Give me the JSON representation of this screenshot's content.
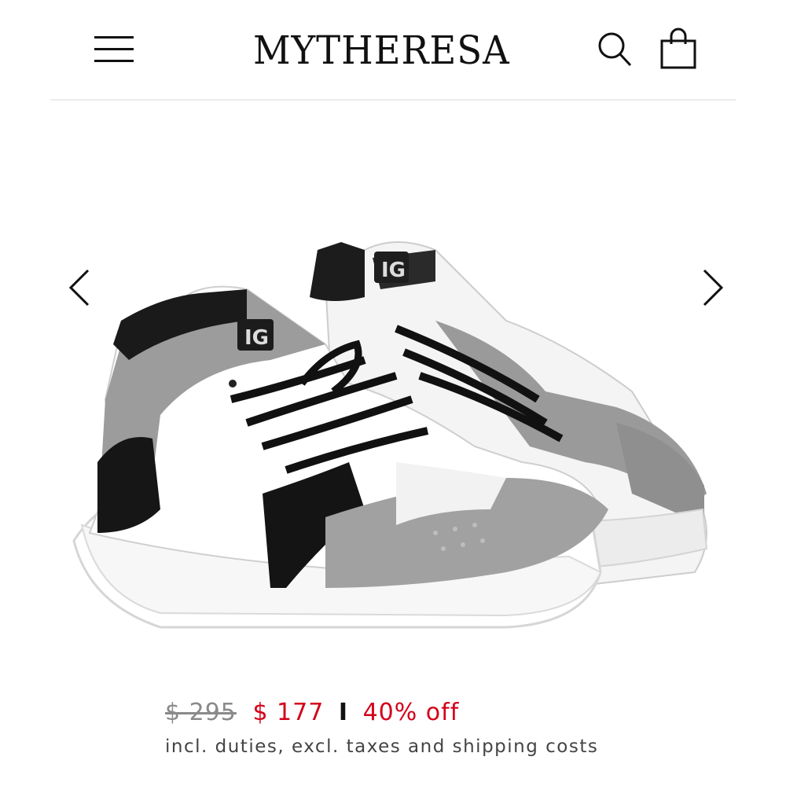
{
  "header": {
    "brand": "MYTHERESA",
    "icons": {
      "menu": "hamburger-menu-icon",
      "search": "search-icon",
      "bag": "shopping-bag-icon"
    }
  },
  "gallery": {
    "image_alt": "White, grey and black leather high-top sneakers with IG tongue logo",
    "prev_icon": "chevron-left-icon",
    "next_icon": "chevron-right-icon"
  },
  "price": {
    "original": "$ 295",
    "current": "$ 177",
    "separator": "I",
    "discount": "40% off",
    "note": "incl. duties, excl. taxes and shipping costs"
  },
  "colors": {
    "sale": "#d4001a",
    "strikethrough": "#8a8a8a",
    "text": "#111111"
  }
}
